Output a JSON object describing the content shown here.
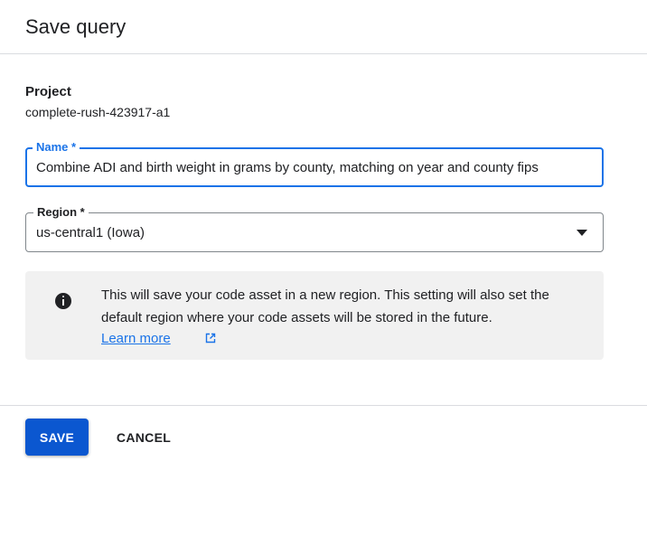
{
  "dialog": {
    "title": "Save query"
  },
  "project": {
    "label": "Project",
    "value": "complete-rush-423917-a1"
  },
  "name_field": {
    "label": "Name *",
    "value": "Combine ADI and birth weight in grams by county, matching on year and county fips"
  },
  "region_field": {
    "label": "Region *",
    "selected": "us-central1 (Iowa)"
  },
  "info": {
    "text": "This will save your code asset in a new region. This setting will also set the default region where your code assets will be stored in the future.",
    "link_label": "Learn more",
    "icon": "info-icon",
    "link_icon": "external-link-icon"
  },
  "actions": {
    "save_label": "SAVE",
    "cancel_label": "CANCEL"
  },
  "colors": {
    "accent": "#1a73e8",
    "primary_button": "#0b57d0",
    "info_background": "#f1f1f1"
  }
}
